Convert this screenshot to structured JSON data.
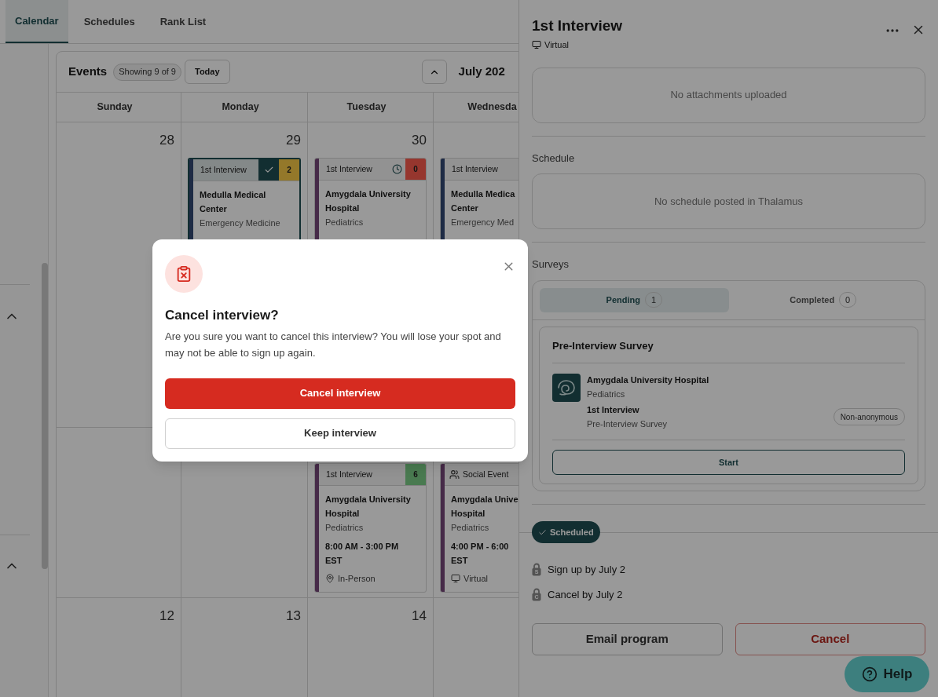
{
  "tabs": [
    {
      "label": "Calendar",
      "selected": true
    },
    {
      "label": "Schedules",
      "selected": false
    },
    {
      "label": "Rank List",
      "selected": false
    }
  ],
  "calendar": {
    "title": "Events",
    "count": "Showing 9 of 9",
    "today": "Today",
    "month": "July 202",
    "days": [
      "Sunday",
      "Monday",
      "Tuesday",
      "Wednesda"
    ],
    "weeks": [
      {
        "cells": [
          {
            "date": "28"
          },
          {
            "date": "29",
            "events": [
              {
                "kind": "interview",
                "label": "1st Interview",
                "confirmed": true,
                "pending": false,
                "count": {
                  "text": "2",
                  "color": "#94782a"
                },
                "color": "#1e2b45",
                "selected": true,
                "name_lines": [
                  "Medulla Medical",
                  "Center"
                ],
                "department": "Emergency Medicine"
              }
            ]
          },
          {
            "date": "30",
            "events": [
              {
                "kind": "interview",
                "label": "1st Interview",
                "confirmed": false,
                "pending": true,
                "count": {
                  "text": "0",
                  "color": "#96362e"
                },
                "color": "#462a48",
                "selected": false,
                "name_lines": [
                  "Amygdala University",
                  "Hospital"
                ],
                "department": "Pediatrics"
              }
            ]
          },
          {
            "events": [
              {
                "kind": "interview",
                "label": "1st Interview",
                "confirmed": false,
                "pending": false,
                "color": "#1e2b45",
                "selected": false,
                "name_lines": [
                  "Medulla Medica",
                  "Center"
                ],
                "department": "Emergency Med"
              }
            ]
          }
        ]
      },
      {
        "cells": [
          {},
          {},
          {
            "events": [
              {
                "kind": "interview",
                "label": "1st Interview",
                "confirmed": false,
                "pending": false,
                "count": {
                  "text": "6",
                  "color": "#4a7a50"
                },
                "color": "#462a48",
                "selected": false,
                "name_lines": [
                  "Amygdala University",
                  "Hospital"
                ],
                "department": "Pediatrics",
                "time_lines": [
                  "8:00 AM - 3:00 PM",
                  "EST"
                ],
                "location": {
                  "kind": "in_person",
                  "label": "In-Person"
                }
              }
            ]
          },
          {
            "events": [
              {
                "kind": "social",
                "label": "Social Event",
                "confirmed": false,
                "pending": false,
                "color": "#462a48",
                "selected": false,
                "name_lines": [
                  "Amygdala Unive",
                  "Hospital"
                ],
                "department": "Pediatrics",
                "time_lines": [
                  "4:00 PM - 6:00",
                  "EST"
                ],
                "location": {
                  "kind": "virtual",
                  "label": "Virtual"
                }
              }
            ]
          }
        ]
      },
      {
        "cells": [
          {
            "date": "12"
          },
          {
            "date": "13"
          },
          {
            "date": "14"
          },
          {}
        ]
      }
    ]
  },
  "panel": {
    "title": "1st Interview",
    "format": {
      "kind": "virtual",
      "label": "Virtual"
    },
    "attachments": "No attachments uploaded",
    "schedule_heading": "Schedule",
    "schedule_empty": "No schedule posted in Thalamus",
    "surveys_heading": "Surveys",
    "survey_tabs": [
      {
        "label": "Pending",
        "count": "1",
        "selected": true
      },
      {
        "label": "Completed",
        "count": "0",
        "selected": false
      }
    ],
    "survey": {
      "title": "Pre-Interview Survey",
      "program": "Amygdala University Hospital",
      "department": "Pediatrics",
      "event": "1st Interview",
      "survey_name": "Pre-Interview Survey",
      "tag": "Non-anonymous",
      "action": "Start"
    },
    "status": "Scheduled",
    "deadlines": [
      {
        "letter": "S",
        "text": "Sign up by July 2"
      },
      {
        "letter": "C",
        "text": "Cancel by July 2"
      }
    ],
    "buttons": [
      {
        "kind": "secondary",
        "label": "Email program"
      },
      {
        "kind": "danger",
        "label": "Cancel"
      }
    ]
  },
  "help": "Help",
  "dialog": {
    "title": "Cancel interview?",
    "body": "Are you sure you want to cancel this interview? You will lose your spot and may not be able to sign up again.",
    "confirm": "Cancel interview",
    "dismiss": "Keep interview"
  }
}
